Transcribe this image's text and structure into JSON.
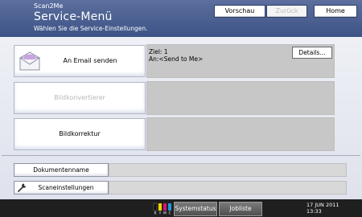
{
  "header": {
    "app_name": "Scan2Me",
    "title": "Service-Menü",
    "subtitle": "Wählen Sie die Service-Einstellungen.",
    "buttons": {
      "preview": "Vorschau",
      "back": "Zurück",
      "home": "Home"
    }
  },
  "rows": [
    {
      "label": "An Email senden",
      "icon": "envelope-icon",
      "enabled": true,
      "panel": {
        "destination": "Ziel: 1",
        "recipient": "An:<Send to Me>",
        "details_label": "Details..."
      }
    },
    {
      "label": "Bildkonvertierer",
      "enabled": false
    },
    {
      "label": "Bildkorrektur",
      "enabled": true
    }
  ],
  "settings": {
    "document_name_label": "Dokumentenname",
    "document_name_value": "",
    "scan_settings_label": "Scaneinstellungen",
    "scan_settings_icon": "wrench-icon",
    "scan_settings_value": ""
  },
  "statusbar": {
    "toner_letters": [
      "K",
      "Y",
      "M",
      "C"
    ],
    "toner_colors": [
      "#111111",
      "#f2d600",
      "#d4147a",
      "#1c9bd8"
    ],
    "system_status_label": "Systemstatus",
    "job_list_label": "Jobliste",
    "date": "17 JUN  2011",
    "time": "13:33"
  }
}
